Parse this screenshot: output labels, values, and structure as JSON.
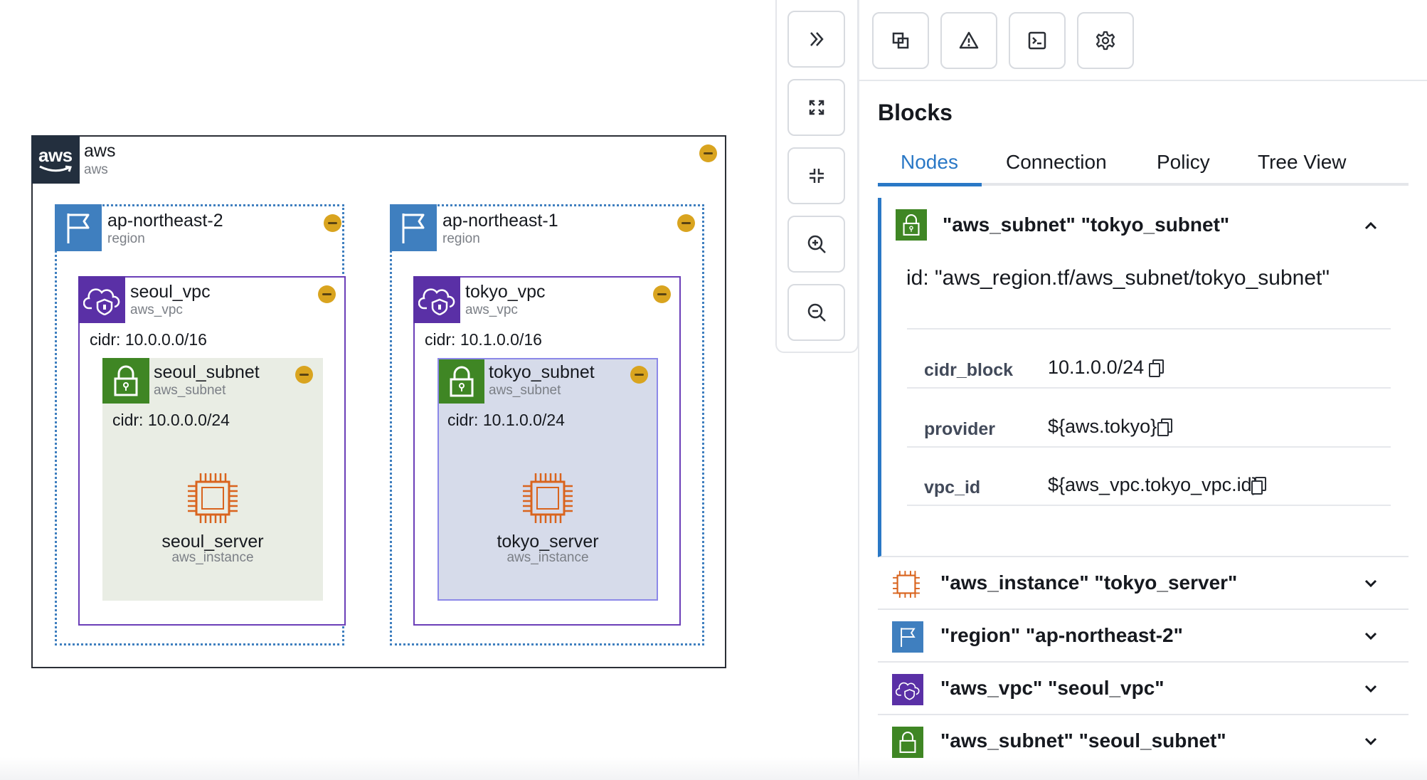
{
  "diagram": {
    "aws": {
      "title": "aws",
      "subtitle": "aws",
      "logo_text": "aws"
    },
    "regions": [
      {
        "title": "ap-northeast-2",
        "subtitle": "region",
        "vpc": {
          "title": "seoul_vpc",
          "subtitle": "aws_vpc",
          "cidr": "cidr: 10.0.0.0/16",
          "subnet": {
            "title": "seoul_subnet",
            "subtitle": "aws_subnet",
            "cidr": "cidr: 10.0.0.0/24",
            "instance": {
              "title": "seoul_server",
              "subtitle": "aws_instance"
            }
          }
        }
      },
      {
        "title": "ap-northeast-1",
        "subtitle": "region",
        "vpc": {
          "title": "tokyo_vpc",
          "subtitle": "aws_vpc",
          "cidr": "cidr: 10.1.0.0/16",
          "subnet": {
            "title": "tokyo_subnet",
            "subtitle": "aws_subnet",
            "cidr": "cidr: 10.1.0.0/24",
            "instance": {
              "title": "tokyo_server",
              "subtitle": "aws_instance"
            }
          }
        }
      }
    ]
  },
  "toolbar": {
    "buttons": [
      "collapse-panel-icon",
      "fit-view-icon",
      "shrink-icon",
      "zoom-in-icon",
      "zoom-out-icon"
    ]
  },
  "panel": {
    "top_buttons": [
      "resources-icon",
      "warning-icon",
      "terminal-icon",
      "settings-icon"
    ],
    "heading": "Blocks",
    "tabs": [
      {
        "label": "Nodes",
        "active": true
      },
      {
        "label": "Connection",
        "active": false
      },
      {
        "label": "Policy",
        "active": false
      },
      {
        "label": "Tree View",
        "active": false
      }
    ],
    "expanded": {
      "title": "\"aws_subnet\" \"tokyo_subnet\"",
      "id": "id: \"aws_region.tf/aws_subnet/tokyo_subnet\"",
      "properties": [
        {
          "key": "cidr_block",
          "value": "10.1.0.0/24"
        },
        {
          "key": "provider",
          "value": "${aws.tokyo}"
        },
        {
          "key": "vpc_id",
          "value": "${aws_vpc.tokyo_vpc.id}"
        }
      ]
    },
    "collapsed": [
      {
        "title": "\"aws_instance\" \"tokyo_server\"",
        "icon": "instance-icon"
      },
      {
        "title": "\"region\" \"ap-northeast-2\"",
        "icon": "region-flag-icon"
      },
      {
        "title": "\"aws_vpc\" \"seoul_vpc\"",
        "icon": "vpc-icon"
      },
      {
        "title": "\"aws_subnet\" \"seoul_subnet\"",
        "icon": "subnet-lock-icon"
      }
    ]
  },
  "colors": {
    "aws_dark": "#232f3e",
    "region_blue": "#3f7fbf",
    "vpc_purple": "#6b3fb8",
    "subnet_green": "#3f8624",
    "accent": "#2a78c6",
    "instance_orange": "#d9641e",
    "collapse_yellow": "#d9a41f"
  }
}
